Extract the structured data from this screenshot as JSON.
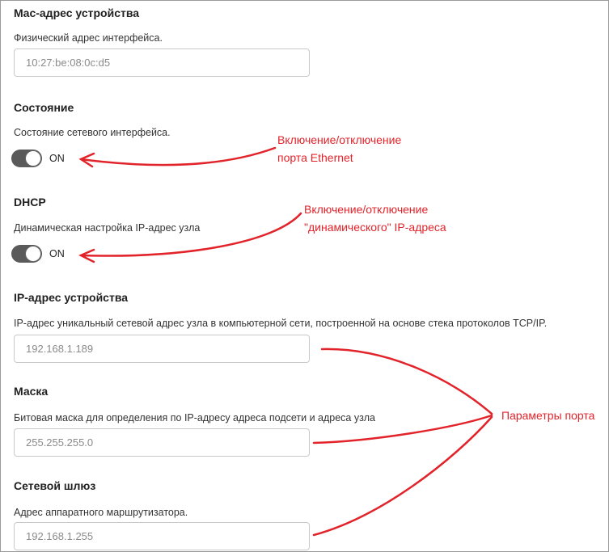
{
  "mac": {
    "title": "Mac-адрес устройства",
    "description": "Физический адрес интерфейса.",
    "value": "10:27:be:08:0c:d5"
  },
  "state": {
    "title": "Состояние",
    "description": "Состояние сетевого интерфейса.",
    "toggle_label": "ON"
  },
  "dhcp": {
    "title": "DHCP",
    "description": "Динамическая настройка IP-адрес узла",
    "toggle_label": "ON"
  },
  "ip": {
    "title": "IP-адрес устройства",
    "description": "IP-адрес уникальный сетевой адрес узла в компьютерной сети, построенной на основе стека протоколов TCP/IP.",
    "value": "192.168.1.189"
  },
  "mask": {
    "title": "Маска",
    "description": "Битовая маска для определения по IP-адресу адреса подсети и адреса узла",
    "value": "255.255.255.0"
  },
  "gateway": {
    "title": "Сетевой шлюз",
    "description": "Адрес аппаратного маршрутизатора.",
    "value": "192.168.1.255"
  },
  "annotations": {
    "ethernet_line1": "Включение/отключение",
    "ethernet_line2": "порта Ethernet",
    "dhcp_line1": "Включение/отключение",
    "dhcp_line2": "\"динамического\" IP-адреса",
    "port_params": "Параметры порта"
  },
  "colors": {
    "annotation": "#e2232a",
    "toggle_track": "#5a5a5a"
  }
}
